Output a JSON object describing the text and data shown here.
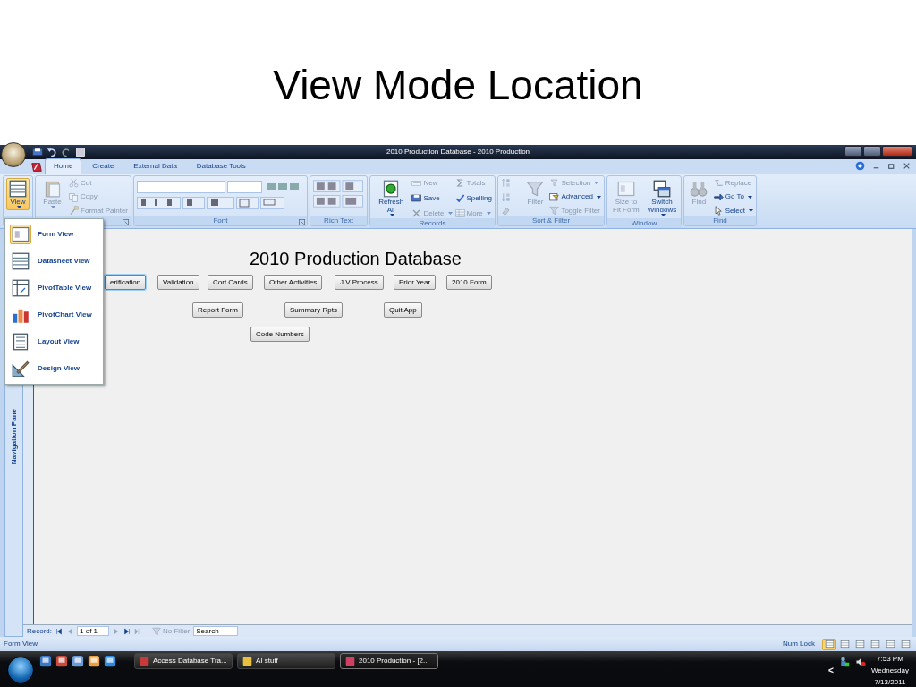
{
  "slide_title": "View Mode Location",
  "window": {
    "title": "2010 Production Database - 2010 Production"
  },
  "tabs": [
    {
      "label": "Home",
      "selected": true
    },
    {
      "label": "Create",
      "selected": false
    },
    {
      "label": "External Data",
      "selected": false
    },
    {
      "label": "Database Tools",
      "selected": false
    }
  ],
  "ribbon": [
    {
      "kind": "buttons",
      "columns": [
        [
          {
            "kind": "large",
            "label": "View",
            "dropdown": true,
            "expanded": true,
            "disabled": false
          }
        ]
      ]
    },
    {
      "kind": "buttons",
      "dialog_launcher": true,
      "columns": [
        [
          {
            "kind": "large",
            "label": "Paste",
            "dropdown": true,
            "expanded": false,
            "disabled": true
          }
        ],
        [
          {
            "kind": "small",
            "label": "Cut",
            "disabled": true
          },
          {
            "kind": "small",
            "label": "Copy",
            "disabled": true
          },
          {
            "kind": "small",
            "label": "Format Painter",
            "disabled": true
          }
        ]
      ]
    },
    {
      "kind": "font",
      "label": "Font",
      "dialog_launcher": true
    },
    {
      "kind": "rich_text",
      "label": "Rich Text"
    },
    {
      "kind": "buttons",
      "label": "Records",
      "columns": [
        [
          {
            "kind": "large",
            "label": "Refresh\nAll",
            "dropdown": true,
            "expanded": false,
            "disabled": false
          }
        ],
        [
          {
            "kind": "small",
            "label": "New",
            "disabled": true
          },
          {
            "kind": "small",
            "label": "Save",
            "disabled": false
          },
          {
            "kind": "small",
            "label": "Delete",
            "dropdown": true,
            "disabled": true
          }
        ],
        [
          {
            "kind": "small",
            "label": "Totals",
            "disabled": true
          },
          {
            "kind": "small",
            "label": "Spelling",
            "disabled": false
          },
          {
            "kind": "small",
            "label": "More",
            "dropdown": true,
            "disabled": true
          }
        ]
      ]
    },
    {
      "kind": "buttons",
      "label": "Sort & Filter",
      "columns": [
        [
          {
            "kind": "icon",
            "disabled": true
          },
          {
            "kind": "icon",
            "disabled": true
          },
          {
            "kind": "icon",
            "disabled": true
          }
        ],
        [
          {
            "kind": "large",
            "label": "Filter",
            "disabled": true
          }
        ],
        [
          {
            "kind": "small",
            "label": "Selection",
            "dropdown": true,
            "disabled": true
          },
          {
            "kind": "small",
            "label": "Advanced",
            "dropdown": true,
            "disabled": false
          },
          {
            "kind": "small",
            "label": "Toggle Filter",
            "disabled": true
          }
        ]
      ]
    },
    {
      "kind": "buttons",
      "label": "Window",
      "columns": [
        [
          {
            "kind": "large",
            "label": "Size to\nFit Form",
            "disabled": true
          }
        ],
        [
          {
            "kind": "large",
            "label": "Switch\nWindows",
            "dropdown": true,
            "disabled": false
          }
        ]
      ]
    },
    {
      "kind": "buttons",
      "label": "Find",
      "columns": [
        [
          {
            "kind": "large",
            "label": "Find",
            "disabled": true
          }
        ],
        [
          {
            "kind": "small",
            "label": "Replace",
            "disabled": true
          },
          {
            "kind": "small",
            "label": "Go To",
            "dropdown": true,
            "disabled": false
          },
          {
            "kind": "small",
            "label": "Select",
            "dropdown": true,
            "disabled": false
          }
        ]
      ]
    }
  ],
  "view_menu": [
    {
      "label": "Form View",
      "selected": true
    },
    {
      "label": "Datasheet View",
      "selected": false
    },
    {
      "label": "PivotTable View",
      "selected": false
    },
    {
      "label": "PivotChart View",
      "selected": false
    },
    {
      "label": "Layout View",
      "selected": false
    },
    {
      "label": "Design View",
      "selected": false
    }
  ],
  "nav_pane": {
    "label": "Navigation Pane"
  },
  "form": {
    "title": "2010 Production Database",
    "buttons": [
      {
        "label": "erification",
        "focused": true
      },
      {
        "label": "Validation",
        "focused": false
      },
      {
        "label": "Cort Cards",
        "focused": false
      },
      {
        "label": "Other Activities",
        "focused": false
      },
      {
        "label": "J V Process",
        "focused": false
      },
      {
        "label": "Prior Year",
        "focused": false
      },
      {
        "label": "2010 Form",
        "focused": false
      },
      {
        "label": "Report Form",
        "focused": false
      },
      {
        "label": "Summary Rpts",
        "focused": false
      },
      {
        "label": "Quit App",
        "focused": false
      },
      {
        "label": "Code Numbers",
        "focused": false
      }
    ]
  },
  "record_nav": {
    "label": "Record:",
    "position": "1 of 1",
    "filter": {
      "label": "No Filter",
      "disabled": true
    },
    "search": {
      "placeholder": "Search"
    }
  },
  "status_bar": {
    "text": "Form View",
    "num_lock": "Num Lock",
    "views": [
      {
        "selected": true
      },
      {
        "selected": false
      },
      {
        "selected": false
      },
      {
        "selected": false
      },
      {
        "selected": false
      },
      {
        "selected": false
      }
    ]
  },
  "taskbar": {
    "tasks": [
      {
        "label": "Access Database Tra...",
        "selected": false
      },
      {
        "label": "AI stuff",
        "selected": false
      },
      {
        "label": "2010 Production - [2...",
        "selected": true
      }
    ],
    "tray_arrow": "<",
    "clock": {
      "time": "7:53 PM",
      "day": "Wednesday",
      "date": "7/13/2011"
    }
  }
}
